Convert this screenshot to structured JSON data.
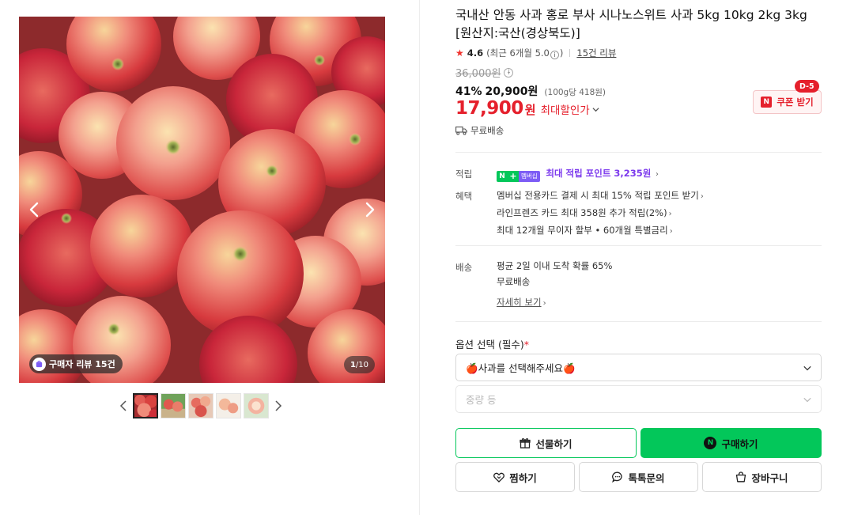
{
  "gallery": {
    "review_badge": "구매자 리뷰 15건",
    "counter_current": "1",
    "counter_total": "/10",
    "prev_icon": "chevron-left-icon",
    "next_icon": "chevron-right-icon"
  },
  "product": {
    "title": "국내산 안동 사과 홍로 부사 시나노스위트 사과 5kg 10kg 2kg 3kg [원산지:국산(경상북도)]",
    "rating": "4.6",
    "rating_recent": "(최근 6개월 5.0",
    "rating_recent_close": ")",
    "review_count": "15건 리뷰",
    "original_price": "36,000원",
    "discount_rate": "41%",
    "discount_price": "20,900원",
    "unit_price": "(100g당 418원)",
    "final_price": "17,900",
    "final_unit": "원",
    "max_discount_label": "최대할인가",
    "shipping": "무료배송"
  },
  "coupon": {
    "label": "쿠폰 받기",
    "dday": "D-5",
    "badge": "N"
  },
  "benefits": {
    "point_label": "적립",
    "point_badge_n": "N",
    "point_badge_plus": "+",
    "point_badge_member": "멤버십",
    "point_text": "최대 적립 포인트 3,235원",
    "benefit_label": "혜택",
    "benefit_items": [
      "멤버십 전용카드 결제 시 최대 15% 적립 포인트 받기",
      "라인프렌즈 카드 최대 358원 추가 적립(2%)",
      "최대 12개월 무이자 할부 • 60개월 특별금리"
    ]
  },
  "delivery": {
    "label": "배송",
    "lines": [
      "평균 2일 이내 도착 확률 65%",
      "무료배송"
    ],
    "more": "자세히 보기"
  },
  "options": {
    "label": "옵션 선택 (필수)",
    "required_mark": "*",
    "select1": "🍎사과를 선택해주세요🍎",
    "select2": "중량 등"
  },
  "actions": {
    "gift": "선물하기",
    "buy": "구매하기",
    "buy_icon_letter": "N",
    "wish": "찜하기",
    "talk": "톡톡문의",
    "cart": "장바구니"
  },
  "colors": {
    "accent_green": "#03c75a",
    "price_red": "#e5202c",
    "point_purple": "#7c3aed"
  }
}
